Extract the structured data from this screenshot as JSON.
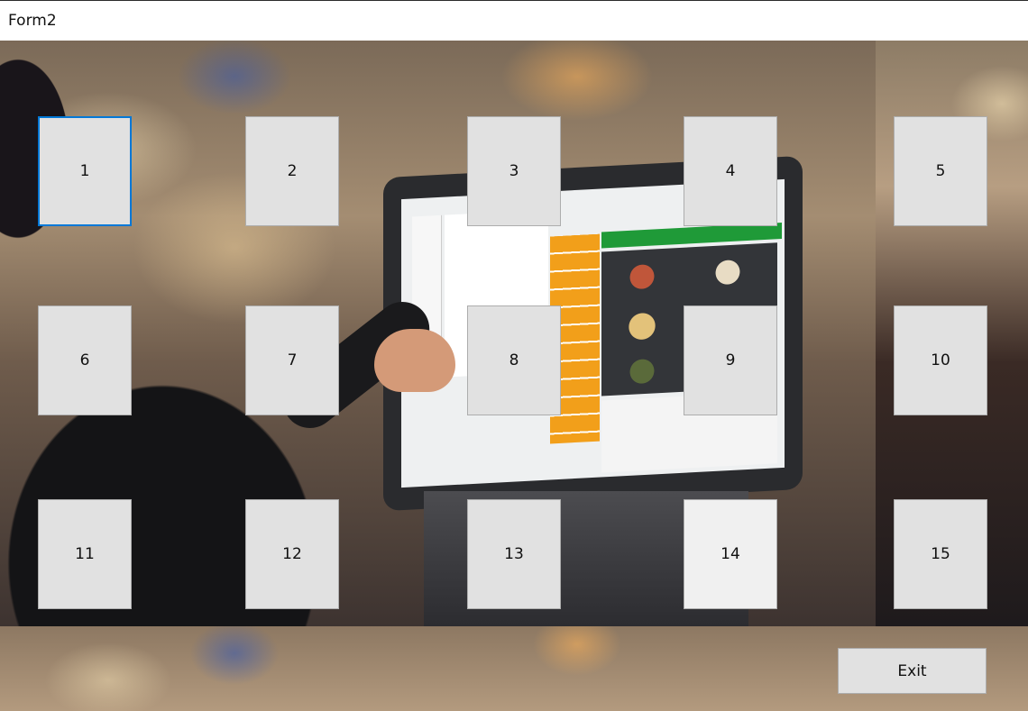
{
  "window": {
    "title": "Form2"
  },
  "tables": [
    {
      "label": "1"
    },
    {
      "label": "2"
    },
    {
      "label": "3"
    },
    {
      "label": "4"
    },
    {
      "label": "5"
    },
    {
      "label": "6"
    },
    {
      "label": "7"
    },
    {
      "label": "8"
    },
    {
      "label": "9"
    },
    {
      "label": "10"
    },
    {
      "label": "11"
    },
    {
      "label": "12"
    },
    {
      "label": "13"
    },
    {
      "label": "14"
    },
    {
      "label": "15"
    }
  ],
  "exit_label": "Exit",
  "colors": {
    "button_face": "#e1e1e1",
    "button_border": "#adadad",
    "focus_border": "#0078d7"
  }
}
